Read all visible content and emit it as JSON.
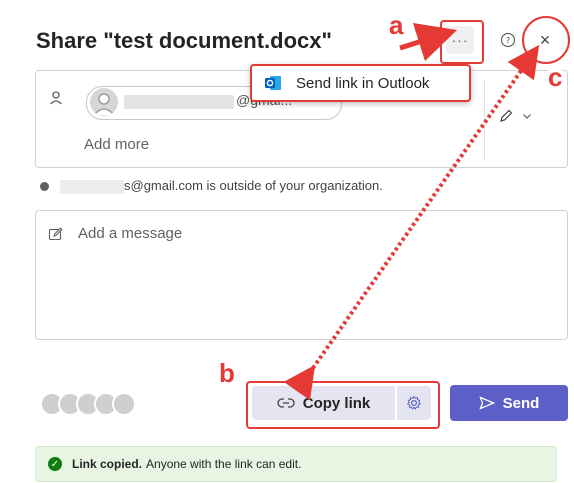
{
  "header": {
    "title": "Share \"test document.docx\"",
    "more_label": "···",
    "help_label": "?",
    "close_label": "×"
  },
  "menu": {
    "send_outlook_label": "Send link in Outlook"
  },
  "recipients": {
    "chip_text": "@gmai...",
    "chip_remove": "×",
    "add_more": "Add more"
  },
  "warning": {
    "text": "s@gmail.com is outside of your organization."
  },
  "message": {
    "placeholder": "Add a message"
  },
  "actions": {
    "copy_link_label": "Copy link",
    "send_label": "Send"
  },
  "toast": {
    "bold": "Link copied.",
    "text": "Anyone with the link can edit."
  },
  "annotations": {
    "a": "a",
    "b": "b",
    "c": "c"
  },
  "colors": {
    "accent": "#5b5fc7",
    "annotation": "#e53935",
    "success": "#107c10"
  }
}
